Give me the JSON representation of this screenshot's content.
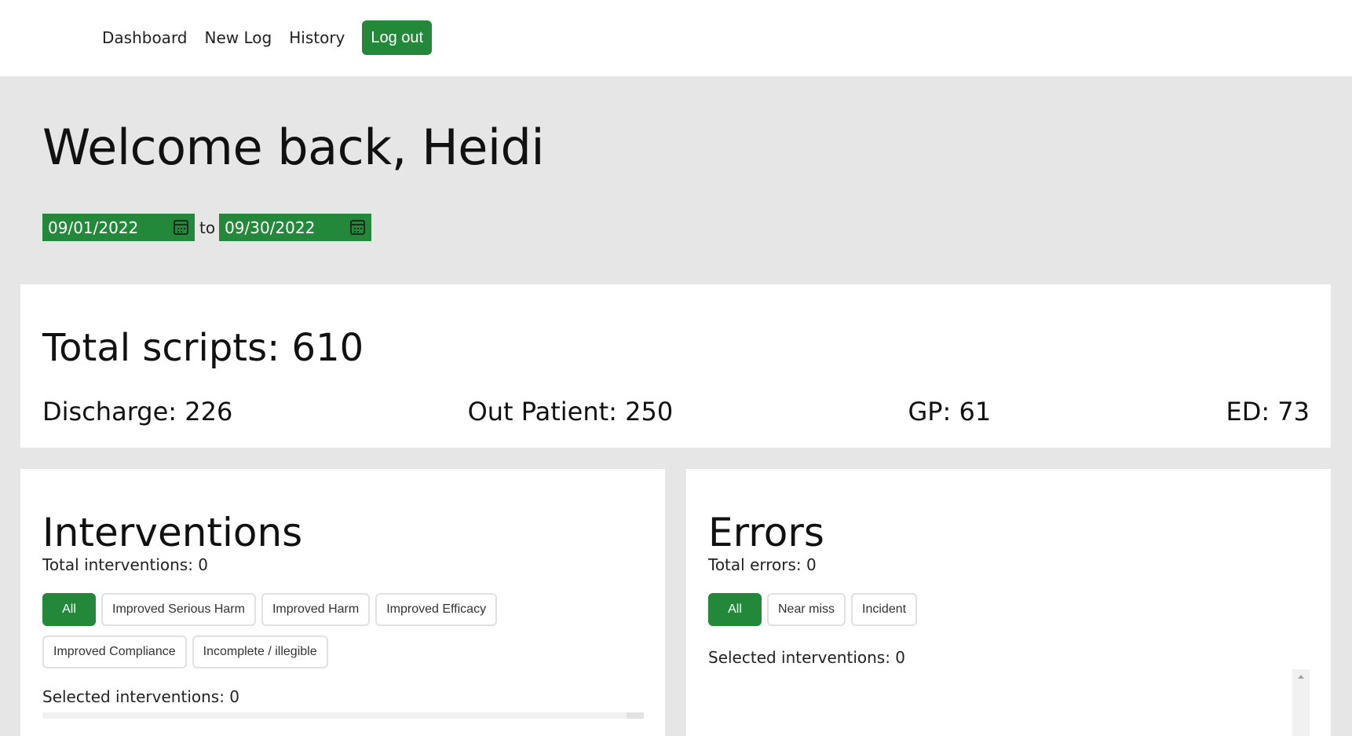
{
  "nav": {
    "dashboard": "Dashboard",
    "new_log": "New Log",
    "history": "History",
    "logout": "Log out"
  },
  "header": {
    "welcome": "Welcome back, Heidi",
    "date_from": "09/01/2022",
    "date_to": "09/30/2022",
    "to_label": "to"
  },
  "totals": {
    "total_scripts": "Total scripts: 610",
    "discharge": "Discharge: 226",
    "out_patient": "Out Patient: 250",
    "gp": "GP: 61",
    "ed": "ED: 73"
  },
  "interventions": {
    "title": "Interventions",
    "total": "Total interventions: 0",
    "filters": [
      "All",
      "Improved Serious Harm",
      "Improved Harm",
      "Improved Efficacy",
      "Improved Compliance",
      "Incomplete / illegible"
    ],
    "selected": "Selected interventions: 0"
  },
  "errors": {
    "title": "Errors",
    "total": "Total errors: 0",
    "filters": [
      "All",
      "Near miss",
      "Incident"
    ],
    "selected": "Selected interventions: 0"
  },
  "colors": {
    "accent": "#23883a",
    "page_bg": "#e6e6e6",
    "card_bg": "#ffffff"
  }
}
